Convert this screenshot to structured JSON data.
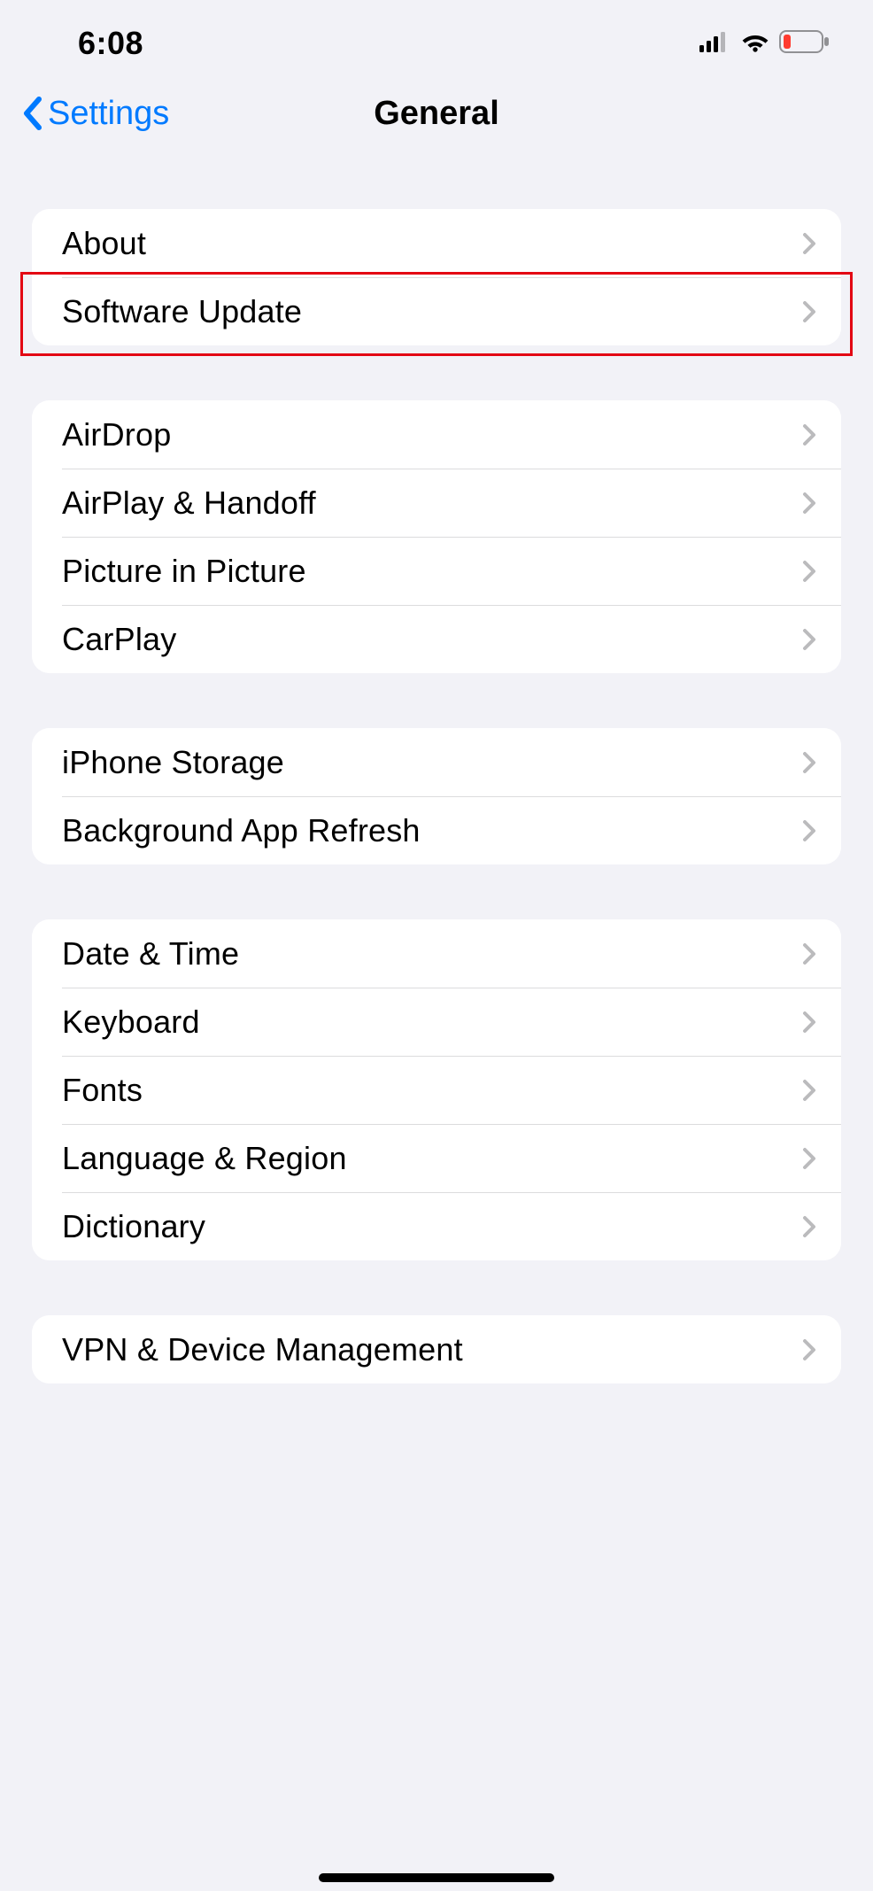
{
  "status": {
    "time": "6:08"
  },
  "nav": {
    "back_label": "Settings",
    "title": "General"
  },
  "groups": [
    {
      "rows": [
        {
          "label": "About",
          "name": "row-about"
        },
        {
          "label": "Software Update",
          "name": "row-software-update"
        }
      ]
    },
    {
      "rows": [
        {
          "label": "AirDrop",
          "name": "row-airdrop"
        },
        {
          "label": "AirPlay & Handoff",
          "name": "row-airplay-handoff"
        },
        {
          "label": "Picture in Picture",
          "name": "row-picture-in-picture"
        },
        {
          "label": "CarPlay",
          "name": "row-carplay"
        }
      ]
    },
    {
      "rows": [
        {
          "label": "iPhone Storage",
          "name": "row-iphone-storage"
        },
        {
          "label": "Background App Refresh",
          "name": "row-background-app-refresh"
        }
      ]
    },
    {
      "rows": [
        {
          "label": "Date & Time",
          "name": "row-date-time"
        },
        {
          "label": "Keyboard",
          "name": "row-keyboard"
        },
        {
          "label": "Fonts",
          "name": "row-fonts"
        },
        {
          "label": "Language & Region",
          "name": "row-language-region"
        },
        {
          "label": "Dictionary",
          "name": "row-dictionary"
        }
      ]
    },
    {
      "rows": [
        {
          "label": "VPN & Device Management",
          "name": "row-vpn-device-management"
        }
      ]
    }
  ],
  "highlight": {
    "target": "row-software-update"
  }
}
